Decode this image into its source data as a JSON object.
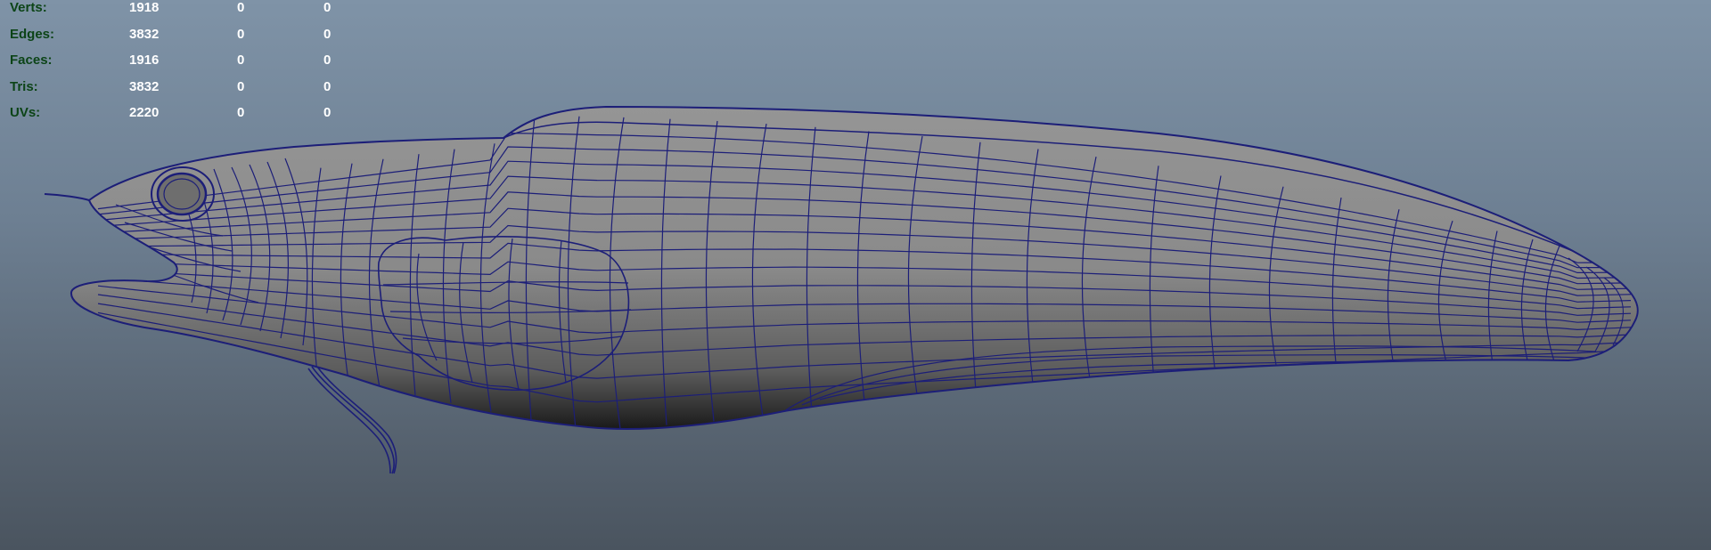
{
  "viewport": {
    "stats": [
      {
        "label": "Verts:",
        "values": [
          "1918",
          "0",
          "0"
        ]
      },
      {
        "label": "Edges:",
        "values": [
          "3832",
          "0",
          "0"
        ]
      },
      {
        "label": "Faces:",
        "values": [
          "1916",
          "0",
          "0"
        ]
      },
      {
        "label": "Tris:",
        "values": [
          "3832",
          "0",
          "0"
        ]
      },
      {
        "label": "UVs:",
        "values": [
          "2220",
          "0",
          "0"
        ]
      }
    ]
  },
  "colors": {
    "background_top": "#7f93a7",
    "background_bottom": "#4a545f",
    "wireframe": "#1c1e78",
    "surface": "#8a8a8a",
    "hud_label": "#0c4417",
    "hud_value": "#ffffff"
  }
}
